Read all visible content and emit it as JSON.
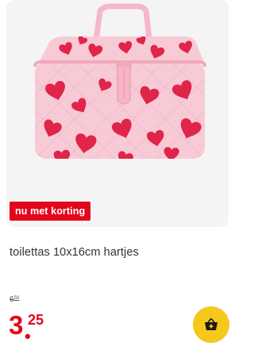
{
  "product": {
    "badge": "nu met korting",
    "title": "toilettas 10x16cm hartjes",
    "old_price": {
      "whole": "6",
      "cents": "50"
    },
    "price": {
      "whole": "3",
      "cents": "25"
    },
    "image_icon": "toiletry-bag-image",
    "cart_icon": "basket-plus-icon"
  },
  "colors": {
    "accent": "#e3051b",
    "cart_button": "#f6c81c",
    "image_bg": "#f4f4f4"
  }
}
